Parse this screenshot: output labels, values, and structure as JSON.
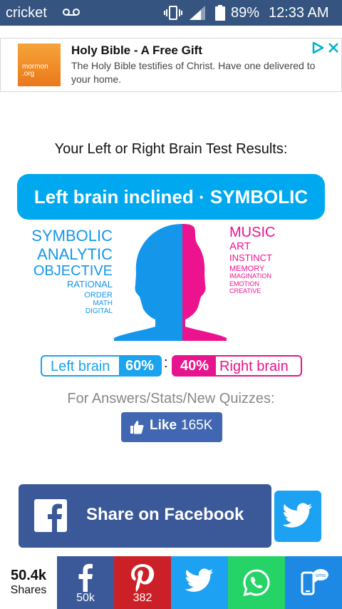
{
  "status_bar": {
    "carrier": "cricket",
    "battery": "89%",
    "time": "12:33 AM"
  },
  "ad": {
    "logo_text": "mormon\n.org",
    "title": "Holy Bible - A Free Gift",
    "body": "The Holy Bible testifies of Christ. Have one delivered to your home."
  },
  "page": {
    "heading": "Your Left or Right Brain Test Results:",
    "result_banner": "Left brain inclined · SYMBOLIC"
  },
  "brain": {
    "left_words": [
      "SYMBOLIC",
      "ANALYTIC",
      "OBJECTIVE",
      "RATIONAL",
      "ORDER",
      "MATH",
      "DIGITAL"
    ],
    "right_words": [
      "MUSIC",
      "ART",
      "INSTINCT",
      "MEMORY",
      "IMAGINATION",
      "EMOTION",
      "CREATIVE"
    ],
    "left_color": "#1496ea",
    "right_color": "#ec138f"
  },
  "percentages": {
    "left_label": "Left brain",
    "left_value": "60%",
    "separator": ":",
    "right_value": "40%",
    "right_label": "Right brain"
  },
  "answers_text": "For Answers/Stats/New Quizzes:",
  "like_button": {
    "label": "Like",
    "count": "165K"
  },
  "share_facebook_label": "Share on Facebook",
  "share_bar": {
    "total": "50.4k",
    "total_label": "Shares",
    "facebook_count": "50k",
    "pinterest_count": "382"
  },
  "colors": {
    "status_bar": "#35547f",
    "facebook": "#3b5998",
    "twitter": "#1da1f2",
    "pinterest": "#cb2027",
    "whatsapp": "#25d366",
    "sms": "#1e88e5",
    "banner": "#00a8f0"
  }
}
